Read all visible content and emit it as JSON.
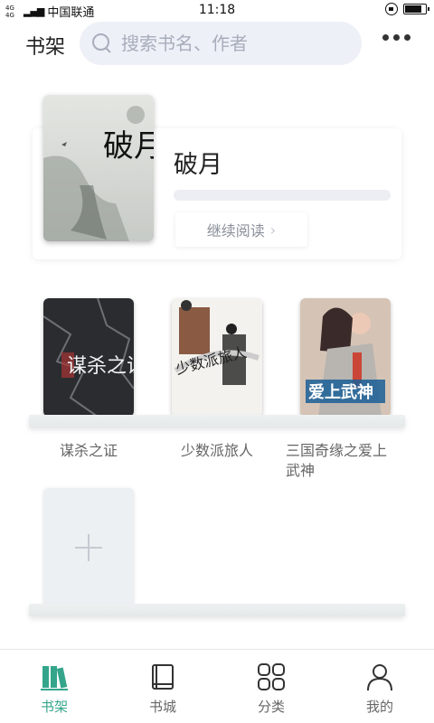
{
  "status": {
    "network": "4G 4G",
    "carrier": "中国联通",
    "time": "11:18"
  },
  "header": {
    "title": "书架",
    "search_placeholder": "搜索书名、作者"
  },
  "featured": {
    "title": "破月",
    "cover_text": "破月",
    "progress": 0.0,
    "continue_label": "继续阅读"
  },
  "shelf": {
    "books": [
      {
        "title": "谋杀之证",
        "cover_text": "谋杀之证"
      },
      {
        "title": "少数派旅人",
        "cover_text": "少数派旅人"
      },
      {
        "title": "三国奇缘之爱上武神",
        "cover_text": "爱上武神"
      }
    ]
  },
  "nav": {
    "items": [
      {
        "label": "书架",
        "icon": "bookshelf-icon",
        "active": true
      },
      {
        "label": "书城",
        "icon": "book-icon",
        "active": false
      },
      {
        "label": "分类",
        "icon": "grid-icon",
        "active": false
      },
      {
        "label": "我的",
        "icon": "user-icon",
        "active": false
      }
    ]
  },
  "colors": {
    "accent": "#34a58b",
    "search_bg": "#eef0f7"
  }
}
